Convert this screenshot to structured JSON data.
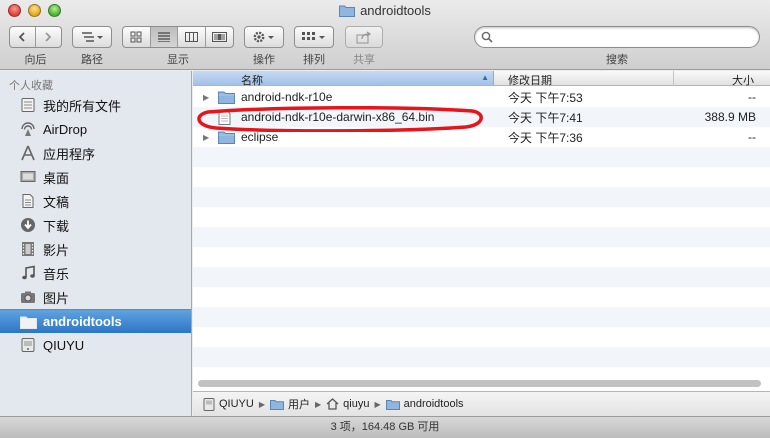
{
  "window": {
    "title": "androidtools"
  },
  "toolbar": {
    "back_label": "向后",
    "path_label": "路径",
    "view_label": "显示",
    "action_label": "操作",
    "arrange_label": "排列",
    "share_label": "共享",
    "search_label": "搜索",
    "search_value": ""
  },
  "sidebar": {
    "heading": "个人收藏",
    "items": [
      {
        "label": "我的所有文件",
        "icon": "all-files-icon"
      },
      {
        "label": "AirDrop",
        "icon": "airdrop-icon"
      },
      {
        "label": "应用程序",
        "icon": "applications-icon"
      },
      {
        "label": "桌面",
        "icon": "desktop-icon"
      },
      {
        "label": "文稿",
        "icon": "documents-icon"
      },
      {
        "label": "下载",
        "icon": "downloads-icon"
      },
      {
        "label": "影片",
        "icon": "movies-icon"
      },
      {
        "label": "音乐",
        "icon": "music-icon"
      },
      {
        "label": "图片",
        "icon": "pictures-icon"
      },
      {
        "label": "androidtools",
        "icon": "folder-icon",
        "selected": true
      },
      {
        "label": "QIUYU",
        "icon": "disk-icon"
      }
    ]
  },
  "columns": {
    "name": "名称",
    "date": "修改日期",
    "size": "大小"
  },
  "files": [
    {
      "name": "android-ndk-r10e",
      "date": "今天 下午7:53",
      "size": "--",
      "kind": "folder"
    },
    {
      "name": "android-ndk-r10e-darwin-x86_64.bin",
      "date": "今天 下午7:41",
      "size": "388.9 MB",
      "kind": "file"
    },
    {
      "name": "eclipse",
      "date": "今天 下午7:36",
      "size": "--",
      "kind": "folder"
    }
  ],
  "pathbar": [
    "QIUYU",
    "用户",
    "qiuyu",
    "androidtools"
  ],
  "status": {
    "text": "3 项，164.48 GB 可用"
  },
  "colors": {
    "selection": "#2d76c7",
    "annotation": "#e8141b",
    "folder": "#8fb6de"
  }
}
